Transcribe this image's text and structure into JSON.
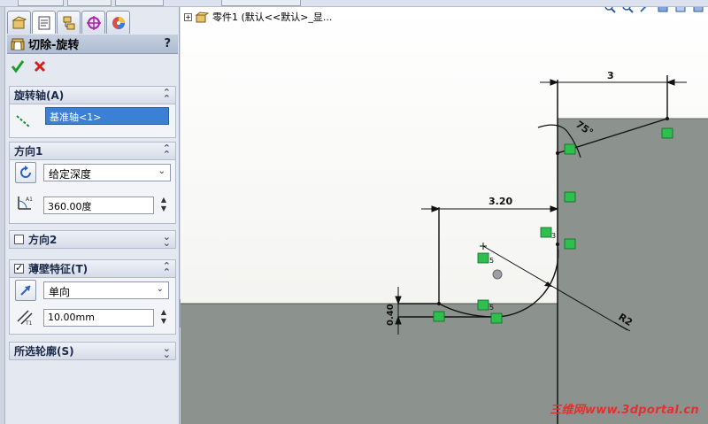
{
  "property_manager": {
    "tabs": [
      {
        "name": "feature-manager-tab-icon"
      },
      {
        "name": "property-manager-tab-icon"
      },
      {
        "name": "configuration-manager-tab-icon"
      },
      {
        "name": "dimxpert-tab-icon"
      },
      {
        "name": "display-manager-tab-icon"
      }
    ],
    "title": "切除-旋转",
    "help": "?",
    "confirm_icon": "green-check-icon",
    "cancel_icon": "red-x-icon",
    "groups": {
      "axis": {
        "title": "旋转轴(A)",
        "value": "基准轴<1>"
      },
      "direction1": {
        "title": "方向1",
        "type": "给定深度",
        "angle": "360.00度"
      },
      "direction2": {
        "title": "方向2",
        "checked": false
      },
      "thin_feature": {
        "title": "薄壁特征(T)",
        "checked": true,
        "type": "单向",
        "thickness": "10.00mm"
      },
      "contours": {
        "title": "所选轮廓(S)"
      }
    }
  },
  "graphics": {
    "tree_item": "零件1   (默认<<默认>_显...",
    "dimensions": {
      "top": "3",
      "middle": "3.20",
      "left": "0.40",
      "radius": "R2",
      "angle": "75°"
    },
    "relation_labels": {
      "a": "3",
      "b": "5",
      "c": "5"
    },
    "colors": {
      "solid": "#8c928e",
      "sketch": "#111111",
      "relation": "#2fbf4f",
      "watermark": "#e23131"
    },
    "watermark": "三维网www.3dportal.cn"
  }
}
